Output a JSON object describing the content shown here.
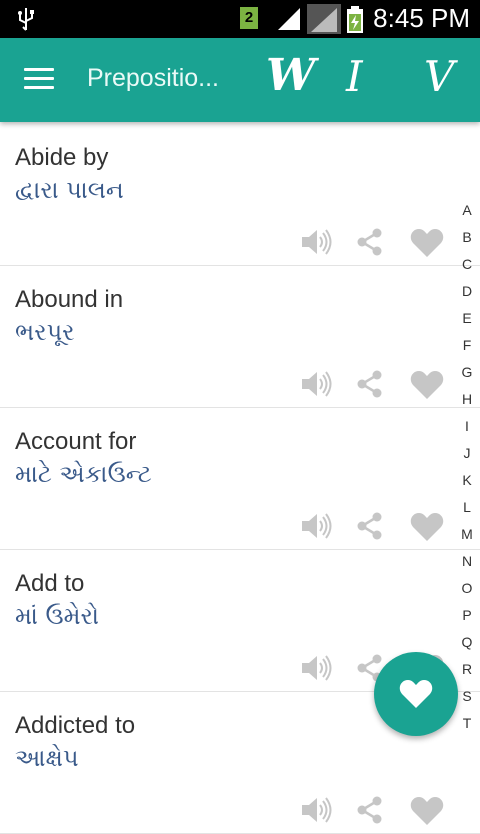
{
  "status_bar": {
    "notification_count": "2",
    "time": "8:45 PM",
    "icons": [
      "usb-icon",
      "signal-icon",
      "signal-icon",
      "battery-charging-icon"
    ]
  },
  "toolbar": {
    "title": "Prepositio...",
    "buttons": [
      {
        "label": "W",
        "icon": "letter-w"
      },
      {
        "label": "I",
        "icon": "letter-i"
      },
      {
        "label": "V",
        "icon": "letter-v"
      }
    ]
  },
  "entries": [
    {
      "word": "Abide by",
      "meaning": "દ્વારા પાલન"
    },
    {
      "word": "Abound in",
      "meaning": "ભરપૂર"
    },
    {
      "word": "Account for",
      "meaning": "માટે એકાઉન્ટ"
    },
    {
      "word": "Add to",
      "meaning": "માં ઉમેરો"
    },
    {
      "word": "Addicted to",
      "meaning": "આક્ષેપ"
    }
  ],
  "alphabet": [
    "A",
    "B",
    "C",
    "D",
    "E",
    "F",
    "G",
    "H",
    "I",
    "J",
    "K",
    "L",
    "M",
    "N",
    "O",
    "P",
    "Q",
    "R",
    "S",
    "T"
  ],
  "colors": {
    "accent": "#1aa392",
    "action_icon": "#c6c6c6",
    "meaning_text": "#3a5a8a"
  }
}
